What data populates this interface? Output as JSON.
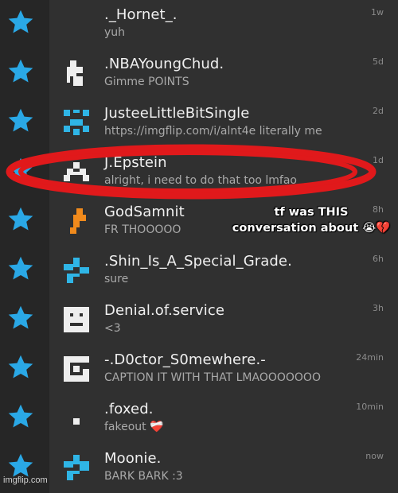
{
  "conversations": [
    {
      "username": "._Hornet_.",
      "message": "yuh",
      "time": "1w",
      "avatar": "blank-avatar"
    },
    {
      "username": ".NBAYoungChud.",
      "message": "Gimme POINTS",
      "time": "5d",
      "avatar": "pixel-avatar"
    },
    {
      "username": "JusteeLittleBitSingle",
      "message": "https://imgflip.com/i/alnt4e literally me",
      "time": "2d",
      "avatar": "pixel-avatar"
    },
    {
      "username": "J.Epstein",
      "message": "alright, i need to do that too lmfao",
      "time": "1d",
      "avatar": "pixel-avatar"
    },
    {
      "username": "GodSamnit",
      "message": "FR THOOOOO",
      "time": "8h",
      "avatar": "pixel-avatar"
    },
    {
      "username": ".Shin_Is_A_Special_Grade.",
      "message": "sure",
      "time": "6h",
      "avatar": "pixel-avatar"
    },
    {
      "username": "Denial.of.service",
      "message": "<3",
      "time": "3h",
      "avatar": "pixel-avatar"
    },
    {
      "username": "-.D0ctor_S0mewhere.-",
      "message": "CAPTION IT WITH THAT LMAOOOOOOO",
      "time": "24min",
      "avatar": "pixel-avatar"
    },
    {
      "username": ".foxed.",
      "message": "fakeout ❤️‍🩹",
      "time": "10min",
      "avatar": "pixel-avatar"
    },
    {
      "username": "Moonie.",
      "message": "BARK BARK :3",
      "time": "now",
      "avatar": "pixel-avatar"
    }
  ],
  "annotation": {
    "line1": "tf was THIS",
    "line2": "conversation about 😭💔"
  },
  "watermark": "imgflip.com",
  "colors": {
    "star": "#2aa8e6",
    "highlight": "#e0191b",
    "avatar_white": "#eeeeee",
    "avatar_cyan": "#2fb5e6",
    "avatar_orange": "#f08a1c"
  }
}
